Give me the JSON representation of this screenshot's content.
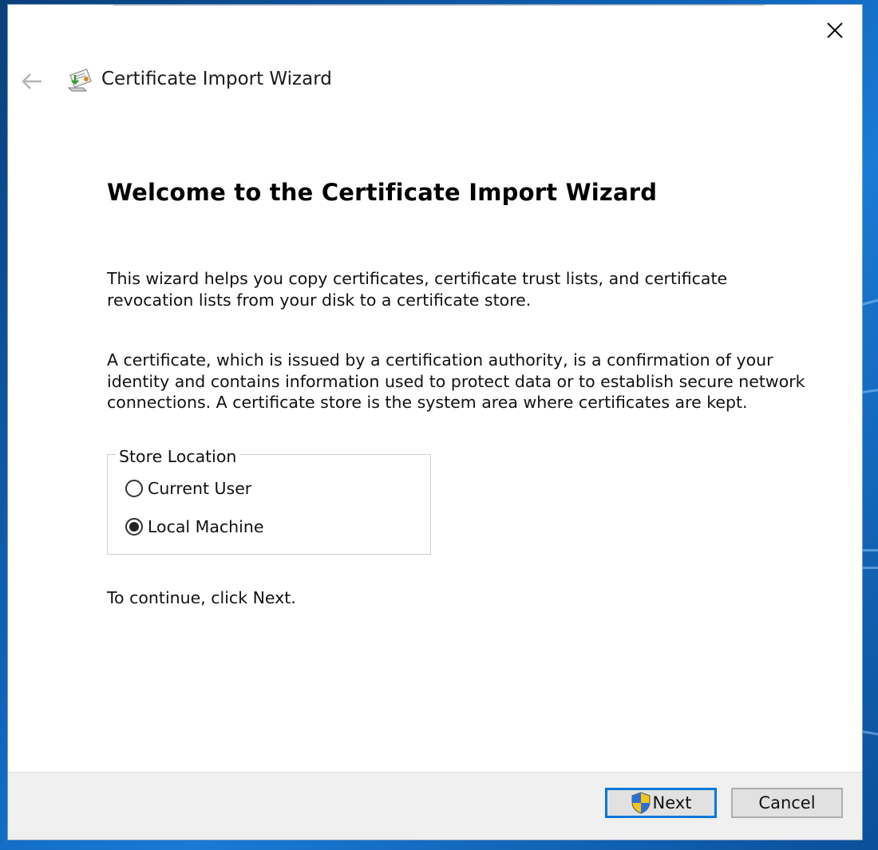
{
  "window": {
    "title": "Certificate Import Wizard",
    "close_icon": "close-icon",
    "back_icon": "back-arrow-icon",
    "app_icon": "certificate-wizard-icon"
  },
  "content": {
    "heading": "Welcome to the Certificate Import Wizard",
    "paragraph1": "This wizard helps you copy certificates, certificate trust lists, and certificate revocation lists from your disk to a certificate store.",
    "paragraph2": "A certificate, which is issued by a certification authority, is a confirmation of your identity and contains information used to protect data or to establish secure network connections. A certificate store is the system area where certificates are kept.",
    "store_location": {
      "legend": "Store Location",
      "options": [
        {
          "label": "Current User",
          "selected": false
        },
        {
          "label": "Local Machine",
          "selected": true
        }
      ]
    },
    "continue_text": "To continue, click Next."
  },
  "footer": {
    "next_label": "Next",
    "next_icon": "uac-shield-icon",
    "cancel_label": "Cancel"
  },
  "colors": {
    "accent": "#0078d7",
    "desktop": "#0f63b8",
    "footer_bg": "#f0f0f0"
  }
}
